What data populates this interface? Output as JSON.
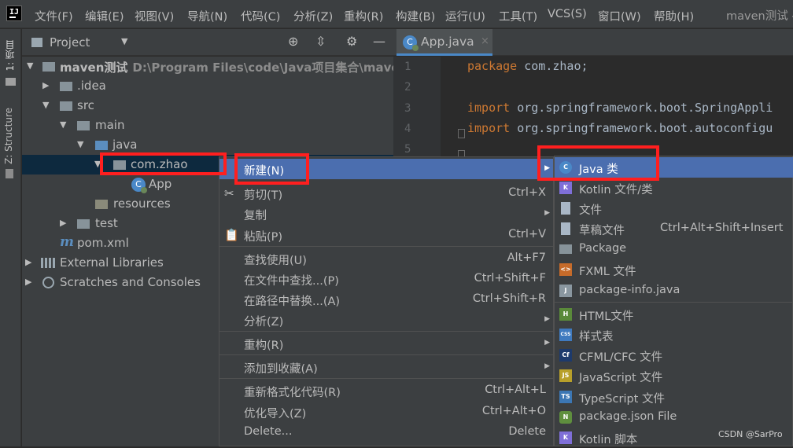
{
  "menubar": {
    "items": [
      "文件(F)",
      "编辑(E)",
      "视图(V)",
      "导航(N)",
      "代码(C)",
      "分析(Z)",
      "重构(R)",
      "构建(B)",
      "运行(U)",
      "工具(T)",
      "VCS(S)",
      "窗口(W)",
      "帮助(H)"
    ],
    "window_title": "maven测试 -"
  },
  "side_tabs": {
    "project": "1: 项目",
    "structure": "Z: Structure"
  },
  "project_panel": {
    "title": "Project",
    "icons": [
      "target-icon",
      "collapse-icon",
      "gear-icon",
      "minimize-icon"
    ]
  },
  "tree": [
    {
      "label": "maven测试",
      "path": "D:\\Program Files\\code\\Java项目集合\\maven测试",
      "arrow": "▼",
      "icon": "module-folder-icon"
    },
    {
      "label": ".idea",
      "arrow": "▶",
      "icon": "folder-icon"
    },
    {
      "label": "src",
      "arrow": "▼",
      "icon": "folder-icon"
    },
    {
      "label": "main",
      "arrow": "▼",
      "icon": "folder-icon"
    },
    {
      "label": "java",
      "arrow": "▼",
      "icon": "source-folder-icon"
    },
    {
      "label": "com.zhao",
      "arrow": "▼",
      "icon": "package-icon"
    },
    {
      "label": "App",
      "arrow": "",
      "icon": "class-icon"
    },
    {
      "label": "resources",
      "arrow": "",
      "icon": "resources-folder-icon"
    },
    {
      "label": "test",
      "arrow": "▶",
      "icon": "folder-icon"
    },
    {
      "label": "pom.xml",
      "arrow": "",
      "icon": "maven-icon"
    },
    {
      "label": "External Libraries",
      "arrow": "▶",
      "icon": "library-icon"
    },
    {
      "label": "Scratches and Consoles",
      "arrow": "▶",
      "icon": "scratches-icon"
    }
  ],
  "editor": {
    "tab_label": "App.java",
    "tab_close": "×",
    "line_numbers": [
      "1",
      "2",
      "3",
      "4",
      "5"
    ],
    "code": {
      "l1_kw": "package",
      "l1_rest": " com.zhao;",
      "l3_kw": "import",
      "l3_rest": " org.springframework.boot.SpringAppli",
      "l4_kw": "import",
      "l4_rest": " org.springframework.boot.autoconfigu"
    }
  },
  "context_menu": {
    "items": [
      {
        "label": "新建(N)",
        "shortcut": "",
        "submenu": true,
        "icon": "",
        "highlighted": true
      },
      {
        "label": "剪切(T)",
        "shortcut": "Ctrl+X",
        "submenu": false,
        "icon": "scissors-icon"
      },
      {
        "label": "复制",
        "shortcut": "",
        "submenu": true,
        "icon": ""
      },
      {
        "label": "粘贴(P)",
        "shortcut": "Ctrl+V",
        "submenu": false,
        "icon": "clipboard-icon"
      },
      {
        "label": "查找使用(U)",
        "shortcut": "Alt+F7",
        "submenu": false,
        "icon": ""
      },
      {
        "label": "在文件中查找...(P)",
        "shortcut": "Ctrl+Shift+F",
        "submenu": false,
        "icon": ""
      },
      {
        "label": "在路径中替换...(A)",
        "shortcut": "Ctrl+Shift+R",
        "submenu": false,
        "icon": ""
      },
      {
        "label": "分析(Z)",
        "shortcut": "",
        "submenu": true,
        "icon": ""
      },
      {
        "label": "重构(R)",
        "shortcut": "",
        "submenu": true,
        "icon": ""
      },
      {
        "label": "添加到收藏(A)",
        "shortcut": "",
        "submenu": true,
        "icon": ""
      },
      {
        "label": "重新格式化代码(R)",
        "shortcut": "Ctrl+Alt+L",
        "submenu": false,
        "icon": ""
      },
      {
        "label": "优化导入(Z)",
        "shortcut": "Ctrl+Alt+O",
        "submenu": false,
        "icon": ""
      },
      {
        "label": "Delete...",
        "shortcut": "Delete",
        "submenu": false,
        "icon": ""
      }
    ]
  },
  "submenu": {
    "items": [
      {
        "label": "Java 类",
        "shortcut": "",
        "icon": "java-class-icon",
        "badge": "C",
        "color": "#4a88c7",
        "highlighted": true
      },
      {
        "label": "Kotlin 文件/类",
        "shortcut": "",
        "icon": "kotlin-file-icon",
        "badge": "K",
        "color": "#7f6fd8"
      },
      {
        "label": "文件",
        "shortcut": "",
        "icon": "file-icon",
        "badge": "",
        "color": "#a9b7c6"
      },
      {
        "label": "草稿文件",
        "shortcut": "Ctrl+Alt+Shift+Insert",
        "icon": "scratch-file-icon",
        "badge": "",
        "color": "#a9b7c6"
      },
      {
        "label": "Package",
        "shortcut": "",
        "icon": "package-icon",
        "badge": "",
        "color": "#87939a"
      },
      {
        "label": "FXML 文件",
        "shortcut": "",
        "icon": "fxml-icon",
        "badge": "<>",
        "color": "#c66b2a"
      },
      {
        "label": "package-info.java",
        "shortcut": "",
        "icon": "java-file-icon",
        "badge": "J",
        "color": "#8a97a0"
      },
      {
        "label": "HTML文件",
        "shortcut": "",
        "icon": "html-icon",
        "badge": "H",
        "color": "#5a8a3a"
      },
      {
        "label": "样式表",
        "shortcut": "",
        "icon": "css-icon",
        "badge": "CSS",
        "color": "#3f7abf"
      },
      {
        "label": "CFML/CFC 文件",
        "shortcut": "",
        "icon": "cfml-icon",
        "badge": "Cf",
        "color": "#1d3a6c"
      },
      {
        "label": "JavaScript 文件",
        "shortcut": "",
        "icon": "javascript-icon",
        "badge": "JS",
        "color": "#b8a02a"
      },
      {
        "label": "TypeScript 文件",
        "shortcut": "",
        "icon": "typescript-icon",
        "badge": "TS",
        "color": "#3c77b4"
      },
      {
        "label": "package.json File",
        "shortcut": "",
        "icon": "nodejs-icon",
        "badge": "N",
        "color": "#5f8f3e"
      },
      {
        "label": "Kotlin 脚本",
        "shortcut": "",
        "icon": "kotlin-script-icon",
        "badge": "K",
        "color": "#7f6fd8"
      }
    ]
  },
  "watermark": "CSDN @SarPro",
  "colors": {
    "highlight": "#4b6eaf",
    "annotation_red": "#ff1f1f",
    "selection": "#0d293e",
    "keyword": "#cc7832"
  }
}
